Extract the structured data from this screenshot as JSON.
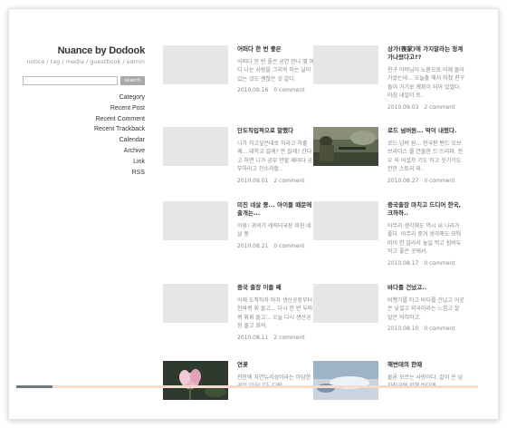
{
  "blog": {
    "title": "Nuance by Dodook",
    "links": [
      "notice",
      "tag",
      "media",
      "guestbook",
      "admin"
    ],
    "search_button": "search"
  },
  "menu": [
    "Category",
    "Recent Post",
    "Recent Comment",
    "Recent Trackback",
    "Calendar",
    "Archive",
    "Link",
    "RSS"
  ],
  "posts": [
    {
      "title": "어떠다 한 번 좋은",
      "body": "어떠다 한 번 좋은 공연 만나 몇 마디 나눈 사람을 그리워 하는 날이 있는 것도 괜찮은 것 같다.",
      "date": "2010.09.16",
      "comments": "0 comment"
    },
    {
      "title": "상가(喪家)에 가지말라는 정계 가나왔다고??",
      "body": "친구 아버님이 노환으로 어제 돌아가셨는데... 오늘출 해서 미쳤 친구들이 가기로 계획이 되어 있었다. 마침 내일이 토..",
      "date": "2010.09.03",
      "comments": "2 comment"
    },
    {
      "title": "단도직입적으로 말했다",
      "body": "니가 하고싶은대로 하라고 하줄께... 대학교 갈래? 안 갈래? 간다고 하면 니가 공부 안할 때야다 공부하라고 잔소리할..",
      "date": "2010.09.01",
      "comments": "2 comment"
    },
    {
      "title": "로드 넘버원... 막이 내렸다.",
      "body": "로드 넘버 원... 한국판 밴드 오브 브라더스 를 연출한 드 드라마. 전우 의 어설프 기도 하고 웃기기도 한한 스토리 와..",
      "date": "2010.08.27",
      "comments": "0 comment"
    },
    {
      "title": "미친 네살 쭝... 아이들 때문에 출개는...",
      "body": "아휴! 귀여기 캐릭터국장 미친 네살 쭝",
      "date": "2010.08.21",
      "comments": "0 comment"
    },
    {
      "title": "중국출장 마치고 드디어 한국, 크하하..",
      "body": "아무리 생각해도 역시 내 나라가 좋다. 아무리 중겨 생각해도 모퉈 머이 한 갈라서 놓일 먹고 힘바두 먹고 좋은 곳에서.",
      "date": "2010.08.17",
      "comments": "0 comment"
    },
    {
      "title": "중국 출장 이들 째",
      "body": "어제 도착하자 마자 생산공장부터 한바퀴 휘 돌고... 다시 한 번 두바퀴 휘휘 돌고... 오늘 다시 생산공장 돌고 회의.",
      "date": "2010.08.11",
      "comments": "2 comment"
    },
    {
      "title": "바다를 건넜고..",
      "body": "비행기를 타고 바다를 건넜고 이곳은 낯설고 외국이라는 느낌고 잘 알은 덕혀하고.",
      "date": "2010.08.10",
      "comments": "0 comment"
    },
    {
      "title": "연꽃",
      "body": "진안에 자연뉴리성이라는 아담한 곳이 있습니다. 다탁",
      "date": "",
      "comments": ""
    },
    {
      "title": "해변데의 한때",
      "body": "물론 모르는 사랑이다. 같이 온 남자친구에 의해 바다에",
      "date": "",
      "comments": ""
    }
  ],
  "colors": {
    "sidebar_text": "#333333",
    "meta_text": "#9a9a9a",
    "thumb_placeholder": "#e6e6e6",
    "search_button": "#a9a9a9"
  }
}
